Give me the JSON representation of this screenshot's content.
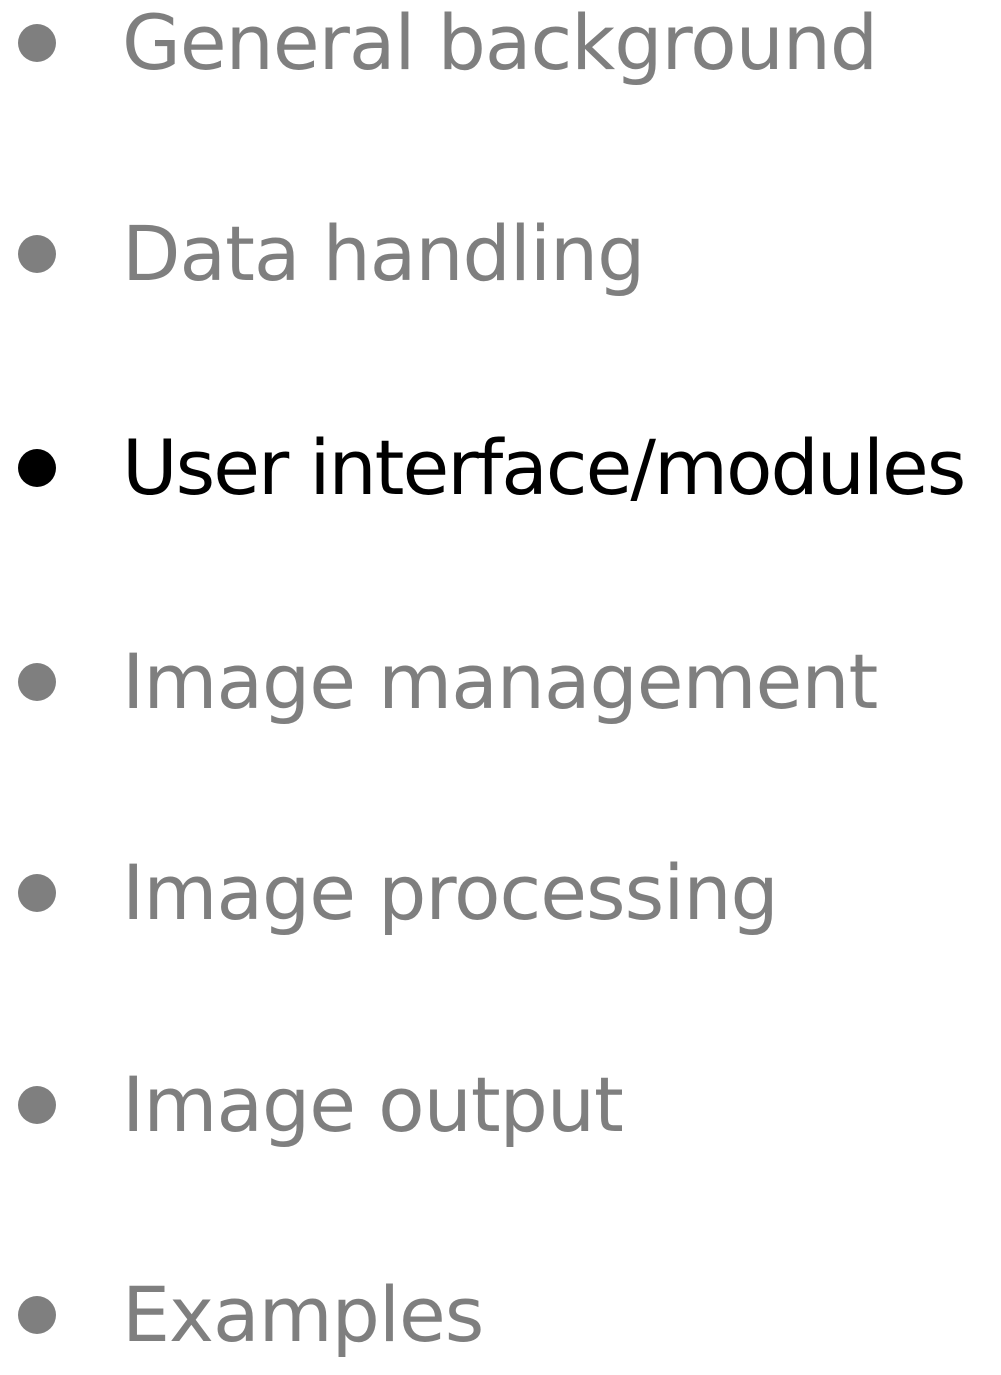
{
  "agenda": {
    "items": [
      {
        "label": "General background",
        "active": false
      },
      {
        "label": "Data handling",
        "active": false
      },
      {
        "label": "User interface/modules",
        "active": true
      },
      {
        "label": "Image management",
        "active": false
      },
      {
        "label": "Image processing",
        "active": false
      },
      {
        "label": "Image output",
        "active": false
      },
      {
        "label": "Examples",
        "active": false
      }
    ]
  },
  "colors": {
    "inactive_text": "#7f7f7f",
    "active_text": "#000000",
    "background": "#ffffff"
  }
}
